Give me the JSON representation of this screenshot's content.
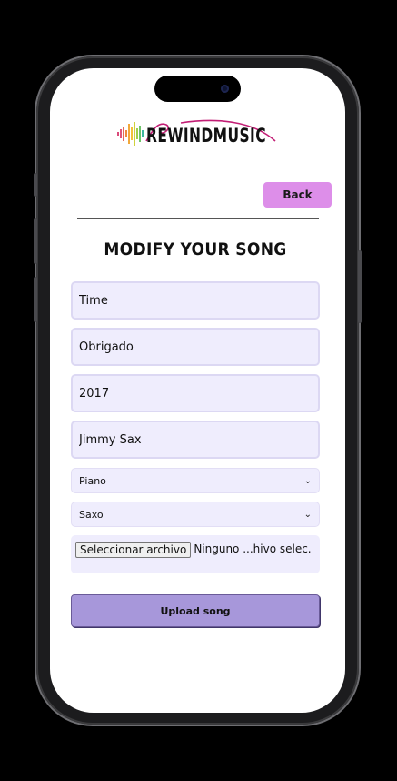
{
  "app": {
    "logo_text": "REWINDMUSIC"
  },
  "header": {
    "back_label": "Back"
  },
  "form": {
    "title": "MODIFY YOUR SONG",
    "fields": [
      {
        "value": "Time"
      },
      {
        "value": "Obrigado"
      },
      {
        "value": "2017"
      },
      {
        "value": "Jimmy Sax"
      }
    ],
    "selects": [
      {
        "selected": "Piano"
      },
      {
        "selected": "Saxo"
      }
    ],
    "file": {
      "button_label": "Seleccionar archivo",
      "status": "Ninguno ...hivo selec."
    },
    "submit_label": "Upload song"
  },
  "colors": {
    "accent_back": "#dd8ee9",
    "input_bg": "#efedfd",
    "submit_bg": "#a797da"
  }
}
